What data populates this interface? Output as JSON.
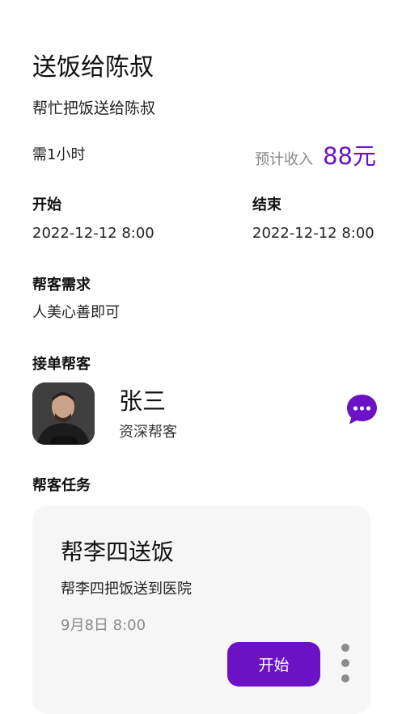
{
  "header": {
    "title": "送饭给陈叔",
    "subtitle": "帮忙把饭送给陈叔"
  },
  "summary": {
    "duration": "需1小时",
    "income_label": "预计收入",
    "income_value": "88元"
  },
  "schedule": {
    "start_label": "开始",
    "start_value": "2022-12-12 8:00",
    "end_label": "结束",
    "end_value": "2022-12-12 8:00"
  },
  "requirement": {
    "label": "帮客需求",
    "value": "人美心善即可"
  },
  "helper": {
    "section_label": "接单帮客",
    "name": "张三",
    "level": "资深帮客",
    "chat_icon": "chat-bubble-icon"
  },
  "task": {
    "section_label": "帮客任务",
    "title": "帮李四送饭",
    "description": "帮李四把饭送到医院",
    "time": "9月8日 8:00",
    "start_button": "开始",
    "more_icon": "more-vertical-icon"
  },
  "colors": {
    "accent": "#6a12c4",
    "muted": "#888888",
    "card_bg": "#f6f6f6"
  }
}
